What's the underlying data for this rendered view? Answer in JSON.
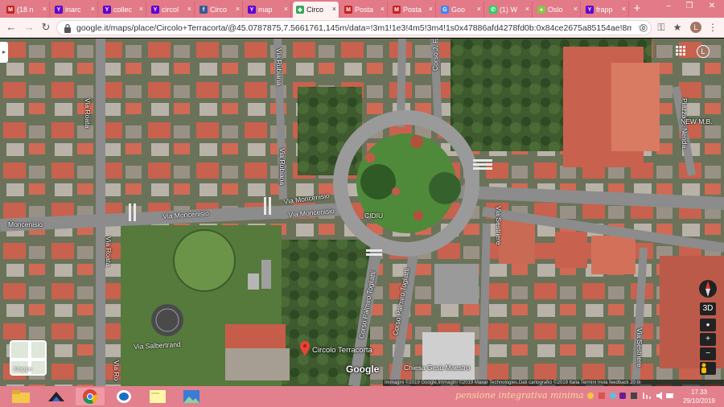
{
  "tabs": [
    {
      "label": "(18 n",
      "icon": "gmail-icon",
      "color": "#c5221f"
    },
    {
      "label": "inarc",
      "icon": "yahoo-icon",
      "color": "#6001d2"
    },
    {
      "label": "collec",
      "icon": "yahoo-icon",
      "color": "#6001d2"
    },
    {
      "label": "circol",
      "icon": "yahoo-icon",
      "color": "#6001d2"
    },
    {
      "label": "Circo",
      "icon": "facebook-icon",
      "color": "#3b5998"
    },
    {
      "label": "map",
      "icon": "yahoo-icon",
      "color": "#6001d2"
    },
    {
      "label": "Circo",
      "icon": "google-maps-icon",
      "color": "#34a853",
      "active": true
    },
    {
      "label": "Posta",
      "icon": "gmail-icon",
      "color": "#c5221f"
    },
    {
      "label": "Posta",
      "icon": "gmail-icon",
      "color": "#c5221f"
    },
    {
      "label": "Goo",
      "icon": "google-translate-icon",
      "color": "#4285f4"
    },
    {
      "label": "(1) W",
      "icon": "whatsapp-icon",
      "color": "#25d366"
    },
    {
      "label": "Oslo",
      "icon": "generic-site-icon",
      "color": "#8bc34a"
    },
    {
      "label": "frapp",
      "icon": "yahoo-icon",
      "color": "#6001d2"
    }
  ],
  "window_controls": {
    "minimize": "–",
    "restore": "❐",
    "close": "✕"
  },
  "address": {
    "url": "google.it/maps/place/Circolo+Terracorta/@45.0787875,7.5661761,145m/data=!3m1!1e3!4m5!3m4!1s0x47886afd4278fd0b:0x84ce2675a85154ae!8m2!3d45.0782286!4d..."
  },
  "profile_initial": "L",
  "map": {
    "labels": {
      "via_roata_top": "Via Roata",
      "via_rubiana_top": "Via Rubiana",
      "corso_kennedy": "Corso J. F. Kennedy",
      "piazza_p_nenda": "Piazza P. Nenda",
      "new_mb": "NEW M.B.",
      "via_rubiana_mid": "Via Rubiana",
      "via_moncenisio_1": "Via Moncenisio",
      "via_moncenisio_2": "Via Moncenisio",
      "via_moncenisio_3": "Via Moncenisio",
      "moncenisio_left": "Moncenisio",
      "cidiu": "CIDIU",
      "via_sestriere_top": "Via Sestriere",
      "via_roata_mid": "Via Roata",
      "corso_togliatti_1": "Corso Palmiro Togliatti",
      "corso_togliatti_2": "Corso Palmiro Togliatti",
      "via_salbertrand": "Via Salbertrand",
      "via_sestriere_bottom": "Via Sestriere",
      "chiesa": "Chiesa Gesù Maestro",
      "via_roata_bottom": "Via Ro"
    },
    "place": "Circolo Terracorta",
    "google_logo": "Google",
    "mappe_label": "Mappe",
    "attribution": "Immagini ©2019 Google,Immagini ©2019 Maxar Technologies,Dati cartografici ©2019    Italia    Termini    Invia feedback     20 m",
    "controls": {
      "compass": "⬍",
      "three_d": "3D",
      "zoom_in": "+",
      "zoom_out": "−",
      "pegman": "pegman-icon"
    }
  },
  "taskbar": {
    "items": [
      "file-explorer-icon",
      "email-client-icon",
      "chrome-icon",
      "outlook-icon",
      "sticky-notes-icon",
      "photos-icon"
    ],
    "ticker": "pensione integrativa minima",
    "clock_time": "17.33",
    "clock_date": "29/10/2019"
  }
}
